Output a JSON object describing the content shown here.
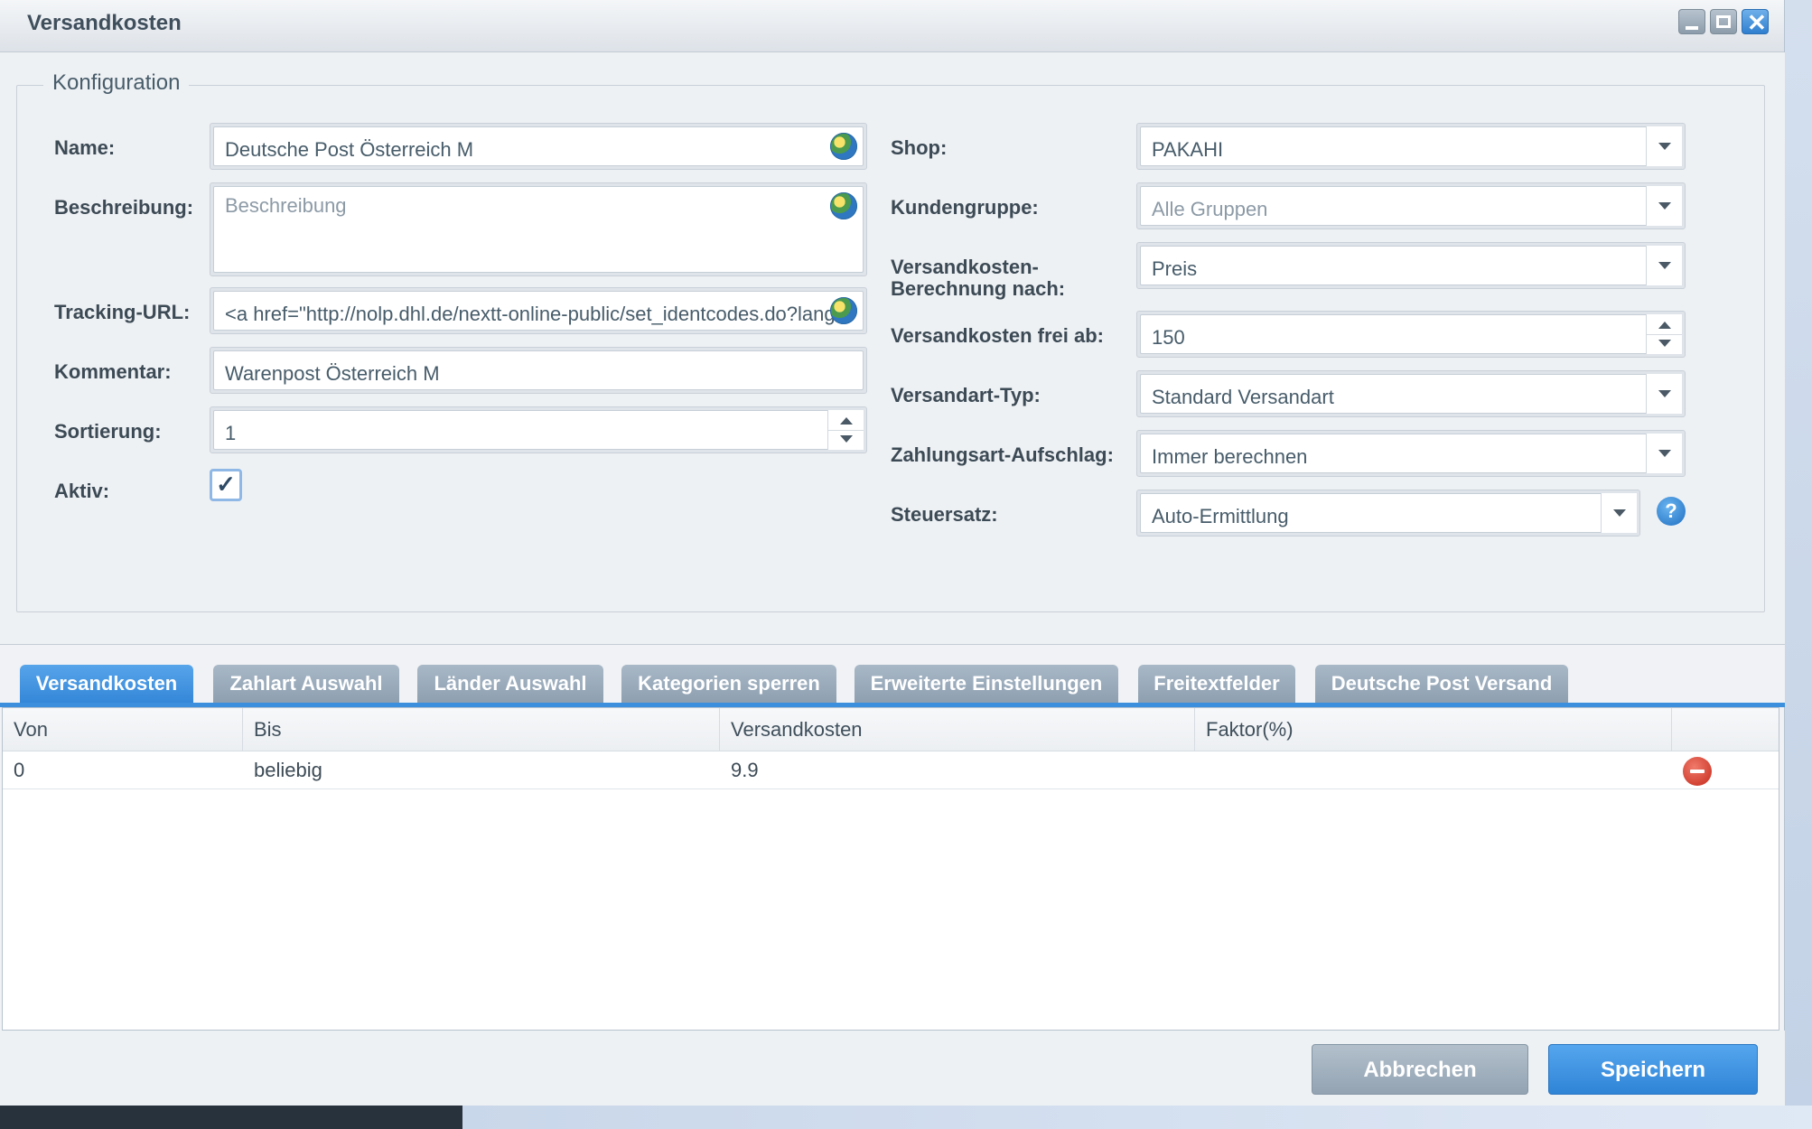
{
  "window": {
    "title": "Versandkosten"
  },
  "config": {
    "legend": "Konfiguration",
    "left": {
      "name_label": "Name:",
      "name_value": "Deutsche Post Österreich M",
      "description_label": "Beschreibung:",
      "description_placeholder": "Beschreibung",
      "tracking_label": "Tracking-URL:",
      "tracking_value": "<a href=\"http://nolp.dhl.de/nextt-online-public/set_identcodes.do?lang",
      "comment_label": "Kommentar:",
      "comment_value": "Warenpost Österreich M",
      "sort_label": "Sortierung:",
      "sort_value": "1",
      "active_label": "Aktiv:",
      "active_checked": "✓"
    },
    "right": {
      "shop_label": "Shop:",
      "shop_value": "PAKAHI",
      "customer_group_label": "Kundengruppe:",
      "customer_group_value": "Alle Gruppen",
      "calc_label_line1": "Versandkosten-",
      "calc_label_line2": "Berechnung nach:",
      "calc_value": "Preis",
      "free_label": "Versandkosten frei ab:",
      "free_value": "150",
      "type_label": "Versandart-Typ:",
      "type_value": "Standard Versandart",
      "surcharge_label": "Zahlungsart-Aufschlag:",
      "surcharge_value": "Immer berechnen",
      "tax_label": "Steuersatz:",
      "tax_value": "Auto-Ermittlung",
      "help_glyph": "?"
    }
  },
  "tabs": [
    {
      "label": "Versandkosten",
      "active": true
    },
    {
      "label": "Zahlart Auswahl"
    },
    {
      "label": "Länder Auswahl"
    },
    {
      "label": "Kategorien sperren"
    },
    {
      "label": "Erweiterte Einstellungen"
    },
    {
      "label": "Freitextfelder"
    },
    {
      "label": "Deutsche Post Versand"
    }
  ],
  "grid": {
    "columns": [
      "Von",
      "Bis",
      "Versandkosten",
      "Faktor(%)"
    ],
    "rows": [
      {
        "von": "0",
        "bis": "beliebig",
        "versandkosten": "9.9",
        "faktor": ""
      }
    ]
  },
  "footer": {
    "cancel_label": "Abbrechen",
    "save_label": "Speichern"
  },
  "colors": {
    "accent": "#3c8fdc",
    "tab_inactive": "#98a8b8",
    "delete": "#d23a2b"
  }
}
